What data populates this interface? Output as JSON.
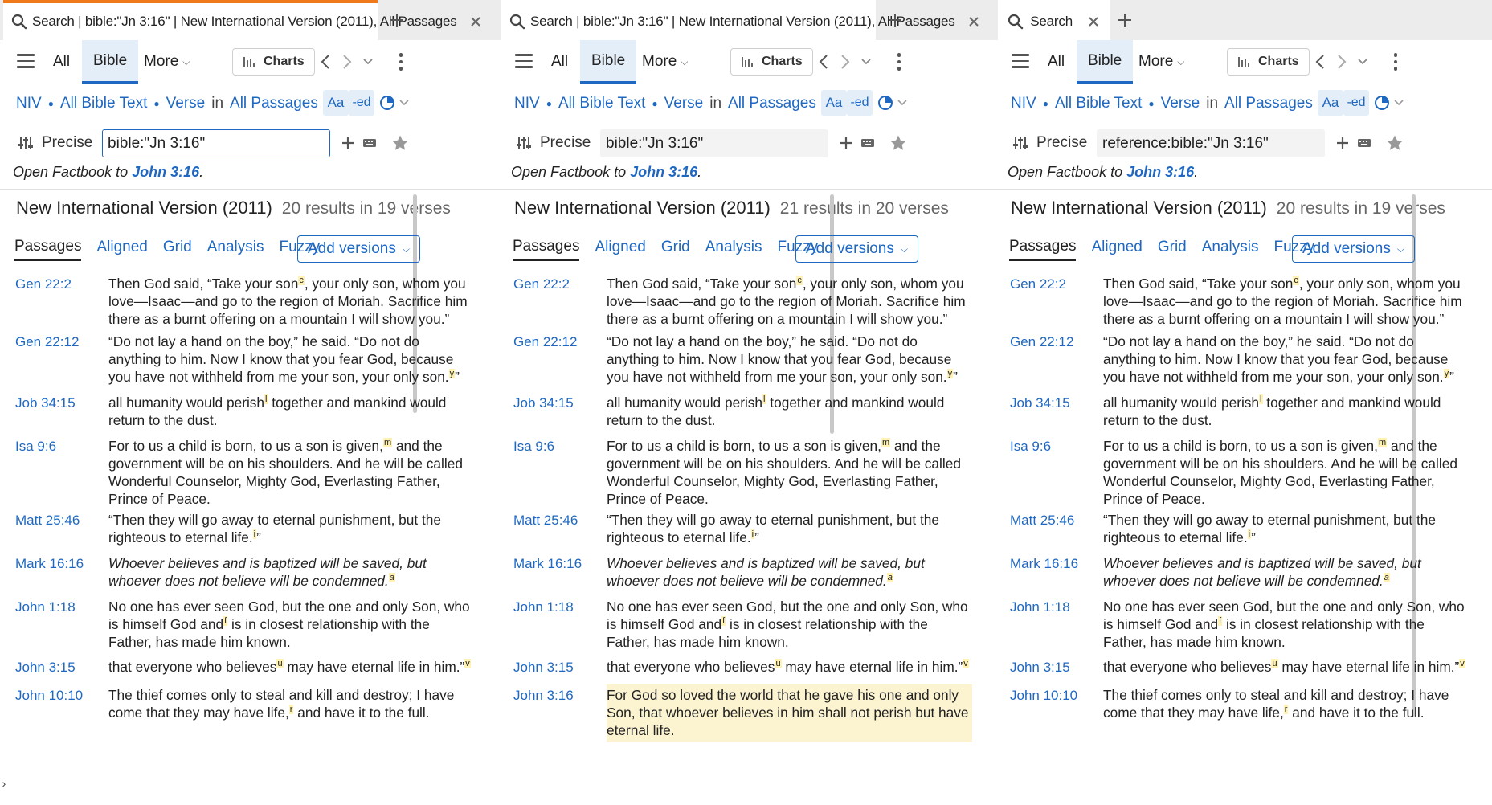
{
  "colors": {
    "accent": "#1f68c1",
    "active_tab_bar": "#f07a1a",
    "highlight": "#fcf4d1",
    "footnote_mark": "#fff2b3"
  },
  "toolbar": {
    "all_label": "All",
    "bible_label": "Bible",
    "more_label": "More",
    "charts_label": "Charts"
  },
  "breadcrumb": {
    "version": "NIV",
    "text": "All Bible Text",
    "unit": "Verse",
    "in_label": "in",
    "range": "All Passages"
  },
  "format_buttons": {
    "font": "Aa",
    "edit": "-ed"
  },
  "search": {
    "mode": "Precise"
  },
  "factbook": {
    "prefix": "Open Factbook to ",
    "reference": "John 3:16",
    "suffix": "."
  },
  "results_version": "New International Version (2011)",
  "view_tabs": [
    "Passages",
    "Aligned",
    "Grid",
    "Analysis",
    "Fuzzy"
  ],
  "add_versions_label": "Add versions",
  "panels": [
    {
      "tab_title": "Search | bible:\"Jn 3:16\" | New International Version (2011), All Passages",
      "query": "bible:\"Jn 3:16\"",
      "count": "20 results in 19 verses"
    },
    {
      "tab_title": "Search | bible:\"Jn 3:16\" | New International Version (2011), All Passages",
      "query": "bible:\"Jn 3:16\"",
      "count": "21 results in 20 verses"
    },
    {
      "tab_title": "Search",
      "query": "reference:bible:\"Jn 3:16\"",
      "count": "20 results in 19 verses"
    }
  ],
  "verses": [
    {
      "ref": "Gen 22:2",
      "segments": [
        [
          "Then God said, “Take your son",
          ""
        ],
        [
          "c",
          "fn"
        ],
        [
          ", your only son, whom you love—Isaac—and go to the region of Moriah. Sacrifice him there as a burnt offering on a mountain I will show you.”",
          ""
        ]
      ]
    },
    {
      "ref": "Gen 22:12",
      "segments": [
        [
          "“Do not lay a hand on the boy,” he said. “Do not do anything to him. Now I know that you fear God, because you have not withheld from me your son, your only son.",
          ""
        ],
        [
          "y",
          "fn"
        ],
        [
          "”",
          ""
        ]
      ]
    },
    {
      "ref": "Job 34:15",
      "segments": [
        [
          "all humanity would perish",
          ""
        ],
        [
          "l",
          "fn"
        ],
        [
          " together and mankind would return to the dust.",
          ""
        ]
      ]
    },
    {
      "ref": "Isa 9:6",
      "segments": [
        [
          "For to us a child is born, to us a son is given,",
          ""
        ],
        [
          "m",
          "fn"
        ],
        [
          " and the government will be on his shoulders. And he will be called Wonderful Counselor, Mighty God, Everlasting Father, Prince of Peace.",
          ""
        ]
      ]
    },
    {
      "ref": "Matt 25:46",
      "segments": [
        [
          "“Then they will go away to eternal punishment, but the righteous to eternal life.",
          ""
        ],
        [
          "i",
          "fn"
        ],
        [
          "”",
          ""
        ]
      ]
    },
    {
      "ref": "Mark 16:16",
      "italic": true,
      "segments": [
        [
          "Whoever believes and is baptized will be saved, but whoever does not believe will be condemned.",
          ""
        ],
        [
          "a",
          "fn"
        ]
      ]
    },
    {
      "ref": "John 1:18",
      "segments": [
        [
          "No one has ever seen God, but the one and only Son, who is himself God and",
          ""
        ],
        [
          "f",
          "fn"
        ],
        [
          " is in closest relationship with the Father, has made him known.",
          ""
        ]
      ]
    },
    {
      "ref": "John 3:15",
      "segments": [
        [
          "that everyone who believes",
          ""
        ],
        [
          "u",
          "fn"
        ],
        [
          " may have eternal life in him.”",
          ""
        ],
        [
          "v",
          "fn"
        ]
      ]
    },
    {
      "ref": "John 10:10",
      "segments": [
        [
          "The thief comes only to steal and kill and destroy; I have come that they may have life,",
          ""
        ],
        [
          "r",
          "fn"
        ],
        [
          " and have it to the full.",
          ""
        ]
      ]
    },
    {
      "ref": "John 3:16",
      "highlight": true,
      "segments": [
        [
          "For God so loved the world that he gave his one and only Son, that whoever believes in him shall not perish but have eternal life.",
          ""
        ]
      ]
    }
  ]
}
